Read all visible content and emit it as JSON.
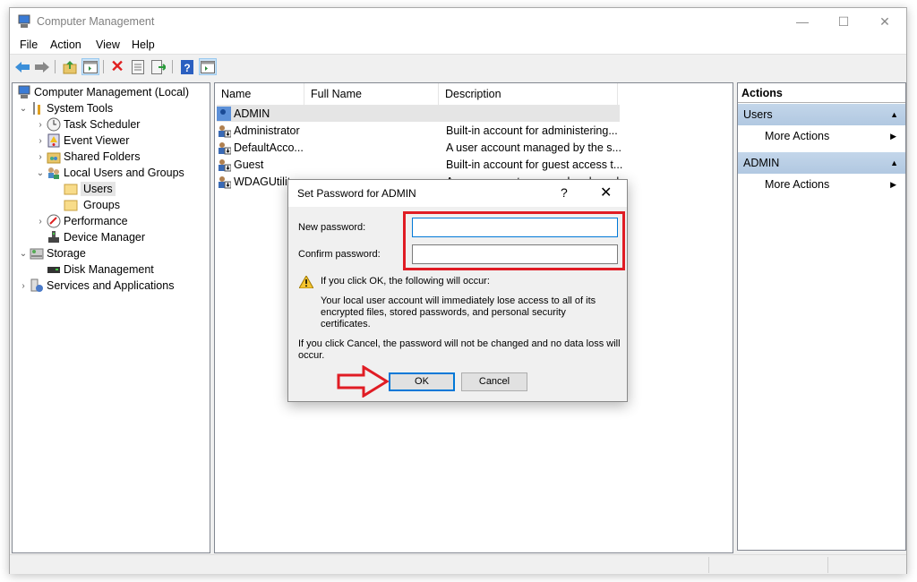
{
  "window": {
    "title": "Computer Management",
    "controls": {
      "minimize": "—",
      "maximize": "☐",
      "close": "✕"
    }
  },
  "menu": [
    "File",
    "Action",
    "View",
    "Help"
  ],
  "toolbar": {
    "icons": [
      "back-icon",
      "forward-icon",
      "up-folder-icon",
      "show-hide-console-tree-icon",
      "delete-icon",
      "properties-icon",
      "export-list-icon",
      "help-icon",
      "show-hide-action-pane-icon"
    ]
  },
  "tree": {
    "items": [
      {
        "label": "Computer Management (Local)",
        "expander": "",
        "icon": "computer-management-icon",
        "level": 0
      },
      {
        "label": "System Tools",
        "expander": "⌄",
        "icon": "tools-icon",
        "level": 1
      },
      {
        "label": "Task Scheduler",
        "expander": "›",
        "icon": "clock-icon",
        "level": 2
      },
      {
        "label": "Event Viewer",
        "expander": "›",
        "icon": "event-viewer-icon",
        "level": 2
      },
      {
        "label": "Shared Folders",
        "expander": "›",
        "icon": "shared-folder-icon",
        "level": 2
      },
      {
        "label": "Local Users and Groups",
        "expander": "⌄",
        "icon": "users-group-icon",
        "level": 2
      },
      {
        "label": "Users",
        "expander": "",
        "icon": "folder-icon",
        "level": 3,
        "selected": true
      },
      {
        "label": "Groups",
        "expander": "",
        "icon": "folder-icon",
        "level": 3
      },
      {
        "label": "Performance",
        "expander": "›",
        "icon": "performance-icon",
        "level": 2
      },
      {
        "label": "Device Manager",
        "expander": "",
        "icon": "device-manager-icon",
        "level": 2
      },
      {
        "label": "Storage",
        "expander": "⌄",
        "icon": "storage-icon",
        "level": 1
      },
      {
        "label": "Disk Management",
        "expander": "",
        "icon": "disk-icon",
        "level": 2
      },
      {
        "label": "Services and Applications",
        "expander": "›",
        "icon": "services-icon",
        "level": 1
      }
    ]
  },
  "list": {
    "columns": [
      "Name",
      "Full Name",
      "Description"
    ],
    "rows": [
      {
        "name": "ADMIN",
        "full_name": "",
        "description": "",
        "selected": true
      },
      {
        "name": "Administrator",
        "full_name": "",
        "description": "Built-in account for administering..."
      },
      {
        "name": "DefaultAcco...",
        "full_name": "",
        "description": "A user account managed by the s..."
      },
      {
        "name": "Guest",
        "full_name": "",
        "description": "Built-in account for guest access t..."
      },
      {
        "name": "WDAGUtilit",
        "full_name": "",
        "description": "A user account managed and used..."
      }
    ]
  },
  "actions": {
    "title": "Actions",
    "sections": [
      {
        "label": "Users",
        "item": "More Actions"
      },
      {
        "label": "ADMIN",
        "item": "More Actions"
      }
    ]
  },
  "dialog": {
    "title": "Set Password for ADMIN",
    "help": "?",
    "close": "✕",
    "new_password_label": "New password:",
    "new_password_value": "",
    "confirm_password_label": "Confirm password:",
    "confirm_password_value": "",
    "warning_heading": "If you click OK, the following will occur:",
    "warning_body": "Your local user account will immediately lose access to all of its encrypted files, stored passwords, and personal security certificates.",
    "cancel_note": "If you click Cancel, the password will not be changed and no data loss will occur.",
    "ok_label": "OK",
    "cancel_label": "Cancel"
  },
  "annotations": {
    "highlight_color": "#e01c24"
  }
}
